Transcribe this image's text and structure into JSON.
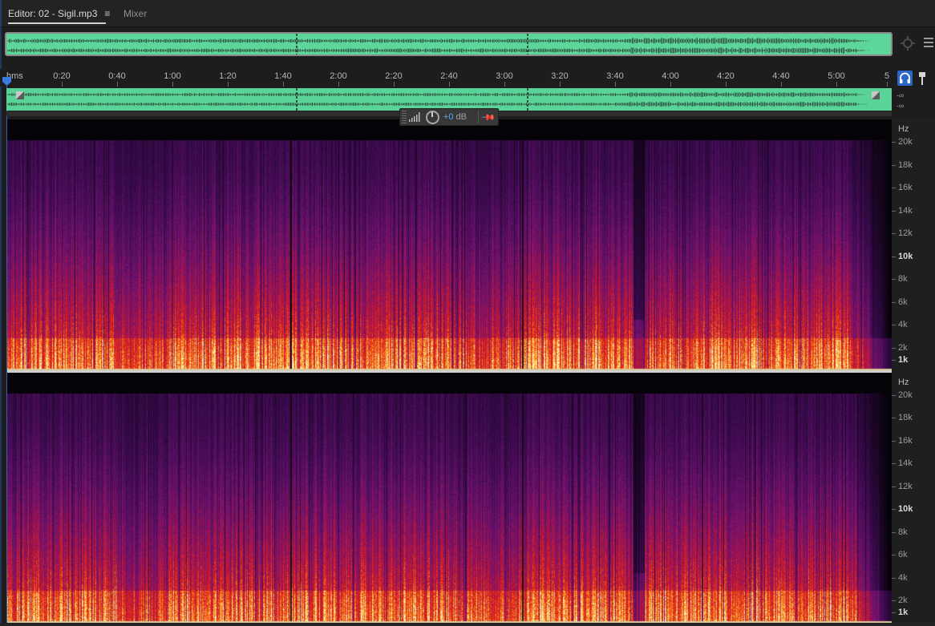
{
  "tabs": {
    "editor_label": "Editor: 02 - Sigil.mp3",
    "editor_menu_glyph": "≡",
    "mixer_label": "Mixer"
  },
  "timeline": {
    "unit": "hms",
    "ticks": [
      "0:20",
      "0:40",
      "1:00",
      "1:20",
      "1:40",
      "2:00",
      "2:20",
      "2:40",
      "3:00",
      "3:20",
      "3:40",
      "4:00",
      "4:20",
      "4:40",
      "5:00",
      "5"
    ]
  },
  "levels": {
    "top": "-∞",
    "bottom": "-∞"
  },
  "hud": {
    "gain_value": "+0",
    "gain_unit": "dB"
  },
  "frequency_axis": {
    "unit": "Hz",
    "labels": [
      "20k",
      "18k",
      "16k",
      "14k",
      "12k",
      "10k",
      "8k",
      "6k",
      "4k",
      "2k",
      "1k"
    ],
    "bold_labels": [
      "10k",
      "1k"
    ]
  },
  "icons": {
    "tab_menu": "hamburger-menu-icon",
    "zoom": "zoom-to-selection-icon",
    "panel_menu": "panel-menu-icon",
    "monitor": "headphones-icon",
    "marker": "marker-pin-icon",
    "hud_meter": "level-meter-icon",
    "hud_knob": "gain-knob-icon",
    "hud_pin": "pin-icon"
  },
  "colors": {
    "waveform": "#5cd69b",
    "accent": "#2b67c9",
    "gain_text": "#4fa6ff",
    "spectral_low": "#f9d76a",
    "spectral_mid": "#e0201c",
    "spectral_high": "#5a1577"
  }
}
